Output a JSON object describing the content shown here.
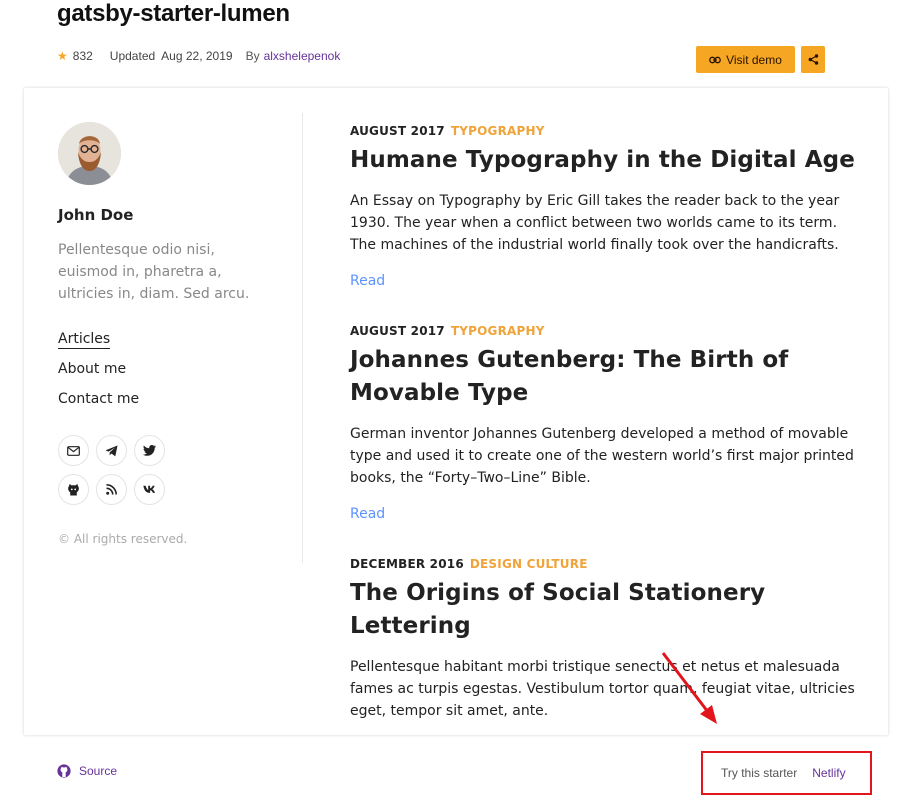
{
  "header": {
    "title": "gatsby-starter-lumen",
    "stars": "832",
    "updated_label": "Updated",
    "updated_date": "Aug 22, 2019",
    "by_label": "By",
    "author": "alxshelepenok",
    "visit_demo_label": "Visit demo"
  },
  "sidebar": {
    "author_name": "John Doe",
    "bio": "Pellentesque odio nisi, euismod in, pharetra a, ultricies in, diam. Sed arcu.",
    "nav": [
      "Articles",
      "About me",
      "Contact me"
    ],
    "socials": [
      "email-icon",
      "telegram-icon",
      "twitter-icon",
      "github-icon",
      "rss-icon",
      "vk-icon"
    ],
    "copyright": "© All rights reserved."
  },
  "articles": [
    {
      "date": "AUGUST 2017",
      "category": "TYPOGRAPHY",
      "title": "Humane Typography in the Digital Age",
      "body": "An Essay on Typography by Eric Gill takes the reader back to the year 1930. The year when a conflict between two worlds came to its term. The machines of the industrial world finally took over the handicrafts.",
      "read": "Read"
    },
    {
      "date": "AUGUST 2017",
      "category": "TYPOGRAPHY",
      "title": "Johannes Gutenberg: The Birth of Movable Type",
      "body": "German inventor Johannes Gutenberg developed a method of movable type and used it to create one of the western world’s first major printed books, the “Forty–Two–Line” Bible.",
      "read": "Read"
    },
    {
      "date": "DECEMBER 2016",
      "category": "DESIGN CULTURE",
      "title": "The Origins of Social Stationery Lettering",
      "body": "Pellentesque habitant morbi tristique senectus et netus et malesuada fames ac turpis egestas. Vestibulum tortor quam, feugiat vitae, ultricies eget, tempor sit amet, ante."
    }
  ],
  "footer": {
    "source_label": "Source",
    "try_label": "Try this starter",
    "netlify_label": "Netlify"
  },
  "colors": {
    "accent": "#f5a623",
    "link_purple": "#663399",
    "category": "#f0a33a",
    "read_link": "#5d93ff",
    "annotation_red": "#e2151d"
  }
}
